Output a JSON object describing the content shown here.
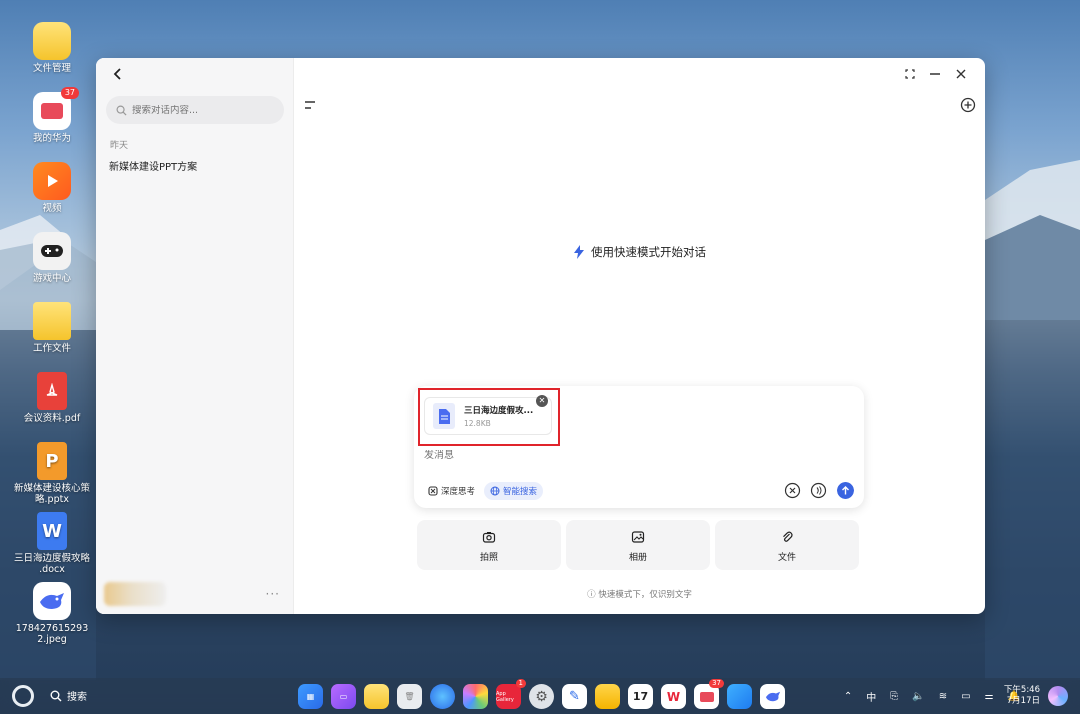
{
  "desktop": {
    "icons": [
      {
        "label": "文件管理",
        "icon": "folder-icon"
      },
      {
        "label": "我的华为",
        "icon": "huawei-icon",
        "badge": "37"
      },
      {
        "label": "视频",
        "icon": "video-icon"
      },
      {
        "label": "游戏中心",
        "icon": "gamepad-icon"
      },
      {
        "label": "工作文件",
        "icon": "folder-icon"
      },
      {
        "label": "会议资料.pdf",
        "icon": "pdf-icon"
      },
      {
        "label": "新媒体建设核心策略.pptx",
        "icon": "pptx-icon",
        "glyph": "P"
      },
      {
        "label": "三日海边度假攻略 .docx",
        "icon": "docx-icon",
        "glyph": "W"
      },
      {
        "label": "1784276152932.jpeg",
        "icon": "image-icon"
      }
    ]
  },
  "sidebar": {
    "search_placeholder": "搜索对话内容...",
    "section_yesterday": "昨天",
    "history_item": "新媒体建设PPT方案",
    "more": "···"
  },
  "main": {
    "hero_text": "使用快速模式开始对话",
    "attachment": {
      "name": "三日海边度假攻...",
      "size": "12.8KB"
    },
    "message_placeholder": "发消息",
    "chip_deep": "深度思考",
    "chip_smart": "智能搜索",
    "actions": [
      {
        "label": "拍照",
        "icon": "camera-icon"
      },
      {
        "label": "相册",
        "icon": "gallery-icon"
      },
      {
        "label": "文件",
        "icon": "paperclip-icon"
      }
    ],
    "footnote": "快速模式下，仅识别文字"
  },
  "taskbar": {
    "search_label": "搜索",
    "dock_badges": {
      "gallery": "1",
      "huawei": "37",
      "calendar_date": "17",
      "gallery_text": "App Gallery"
    },
    "time": "下午5:46",
    "date": "7月17日",
    "ime": "中"
  },
  "colors": {
    "accent": "#3a64e0",
    "highlight_box": "#e0242b"
  }
}
